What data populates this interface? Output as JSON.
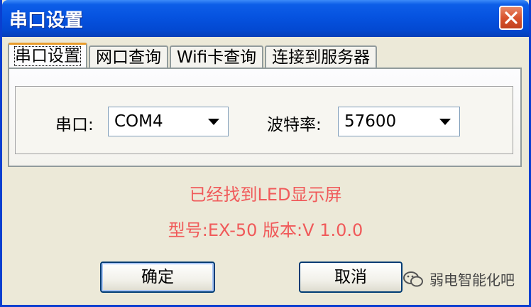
{
  "window": {
    "title": "串口设置",
    "close_icon": "close-icon"
  },
  "tabs": [
    {
      "label": "串口设置",
      "active": true
    },
    {
      "label": "网口查询",
      "active": false
    },
    {
      "label": "Wifi卡查询",
      "active": false
    },
    {
      "label": "连接到服务器",
      "active": false
    }
  ],
  "serial": {
    "port_label": "串口:",
    "port_value": "COM4",
    "baud_label": "波特率:",
    "baud_value": "57600"
  },
  "status": {
    "line1": "已经找到LED显示屏",
    "line2": "型号:EX-50 版本:V 1.0.0",
    "color": "#f05a5a"
  },
  "buttons": {
    "ok": "确定",
    "cancel": "取消"
  },
  "watermark": {
    "text": "弱电智能化吧"
  },
  "colors": {
    "titlebar": "#0653e0",
    "close": "#d8532e",
    "face": "#ece9d8"
  }
}
